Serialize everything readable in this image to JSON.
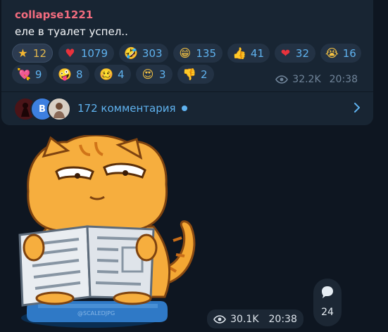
{
  "post": {
    "author": "collapse1221",
    "text": "еле в туалет успел..",
    "views": "32.2K",
    "time": "20:38",
    "reactions": [
      {
        "icon": "star-icon",
        "glyph": "★",
        "color": "#f5b731",
        "count": "12"
      },
      {
        "icon": "heart-icon",
        "glyph": "♥",
        "color": "#e8323c",
        "count": "1079"
      },
      {
        "icon": "rofl-icon",
        "glyph": "🤣",
        "color": "#f6c343",
        "count": "303"
      },
      {
        "icon": "grin-icon",
        "glyph": "😁",
        "color": "#f6c343",
        "count": "135"
      },
      {
        "icon": "thumbs-up-icon",
        "glyph": "👍",
        "color": "#f6c343",
        "count": "41"
      },
      {
        "icon": "heart-on-fire-icon",
        "glyph": "❤",
        "color": "#e8323c",
        "count": "32"
      },
      {
        "icon": "crying-face-icon",
        "glyph": "😭",
        "color": "#f6c343",
        "count": "16"
      },
      {
        "icon": "heart-with-arrow-icon",
        "glyph": "💘",
        "color": "#f266a8",
        "count": "9"
      },
      {
        "icon": "zany-face-icon",
        "glyph": "🤪",
        "color": "#f6c343",
        "count": "8"
      },
      {
        "icon": "woozy-face-icon",
        "glyph": "🥴",
        "color": "#f6c343",
        "count": "4"
      },
      {
        "icon": "heart-eyes-icon",
        "glyph": "😍",
        "color": "#f6c343",
        "count": "3"
      },
      {
        "icon": "thumbs-down-icon",
        "glyph": "👎",
        "color": "#f6c343",
        "count": "2"
      }
    ],
    "comments_label": "172 комментария",
    "avatar_letter": "B"
  },
  "sticker_post": {
    "watermark": "@SCALEDJPG",
    "views": "30.1K",
    "time": "20:38",
    "share_count": "24"
  },
  "colors": {
    "background": "#0e1621",
    "bubble": "#182533",
    "accent": "#5fb2ef",
    "author": "#f36c7f"
  }
}
